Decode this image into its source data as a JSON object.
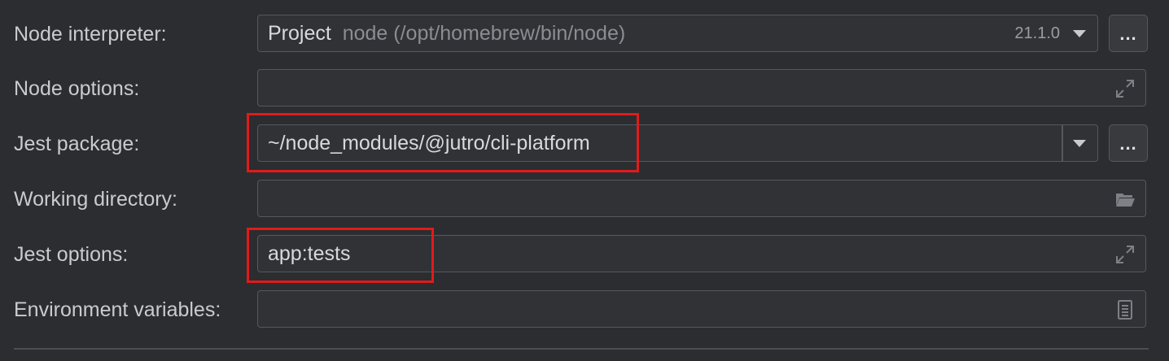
{
  "form": {
    "node_interpreter": {
      "label": "Node interpreter:",
      "value_prefix": "Project",
      "value_detail": "node (/opt/homebrew/bin/node)",
      "version": "21.1.0",
      "more_label": "..."
    },
    "node_options": {
      "label": "Node options:",
      "value": "",
      "icon": "expand-icon"
    },
    "jest_package": {
      "label": "Jest package:",
      "value": "~/node_modules/@jutro/cli-platform",
      "more_label": "..."
    },
    "working_directory": {
      "label": "Working directory:",
      "value": "",
      "icon": "folder-icon"
    },
    "jest_options": {
      "label": "Jest options:",
      "value": "app:tests",
      "icon": "expand-icon"
    },
    "environment_variables": {
      "label": "Environment variables:",
      "value": "",
      "icon": "document-icon"
    }
  },
  "colors": {
    "background": "#2b2d30",
    "field_border": "#55585c",
    "highlight": "#e01b1b"
  }
}
